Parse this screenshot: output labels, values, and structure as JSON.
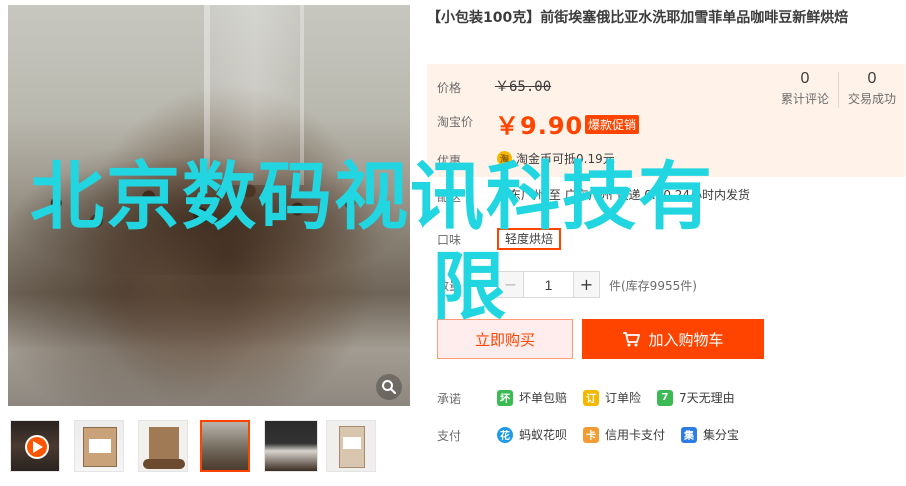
{
  "product": {
    "title": "【小包装100克】前街埃塞俄比亚水洗耶加雪菲单品咖啡豆新鲜烘焙",
    "price_label": "价格",
    "original_price": "￥65.00",
    "promo_label": "淘宝价",
    "promo_price": "￥9.90",
    "promo_tag": "爆款促销",
    "review_count": "0",
    "review_label": "累计评论",
    "sales_count": "0",
    "sales_label": "交易成功",
    "coin_label": "优惠",
    "coin_icon_text": "淘",
    "coin_text": "淘金币可抵0.19元",
    "shipping_label": "配送",
    "shipping_text": "广东广州 至 广东广州 快递 0.00 24小时内发货",
    "taste_label": "口味",
    "taste_option": "轻度烘焙",
    "quantity_label": "数量",
    "quantity_minus": "−",
    "quantity_value": "1",
    "quantity_plus": "+",
    "stock_text": "件(库存9955件)",
    "buy_now": "立即购买",
    "add_to_cart": "加入购物车"
  },
  "promises": {
    "label": "承诺",
    "items": [
      {
        "icon": "broken-package-icon",
        "icon_text": "坏",
        "color": "#3cba54",
        "text": "坏单包赔"
      },
      {
        "icon": "order-insurance-icon",
        "icon_text": "订",
        "color": "#f5b800",
        "text": "订单险"
      },
      {
        "icon": "seven-day-return-icon",
        "icon_text": "7",
        "color": "#3cba54",
        "text": "7天无理由"
      }
    ]
  },
  "payment": {
    "label": "支付",
    "items": [
      {
        "icon": "huabei-icon",
        "icon_text": "花",
        "color": "#1e9be8",
        "text": "蚂蚁花呗"
      },
      {
        "icon": "credit-card-icon",
        "icon_text": "卡",
        "color": "#f39c33",
        "text": "信用卡支付"
      },
      {
        "icon": "jifenbao-icon",
        "icon_text": "集",
        "color": "#2d7be5",
        "text": "集分宝"
      }
    ]
  },
  "watermark": {
    "line1": "北京数码视讯科技有",
    "line2": "限"
  },
  "gallery": {
    "thumbnails": [
      "video-thumbnail",
      "product-bag-thumbnail-1",
      "product-bag-thumbnail-2",
      "coffee-beans-thumbnail",
      "glass-jar-thumbnail",
      "product-bag-thumbnail-3"
    ],
    "active_index": 3
  }
}
